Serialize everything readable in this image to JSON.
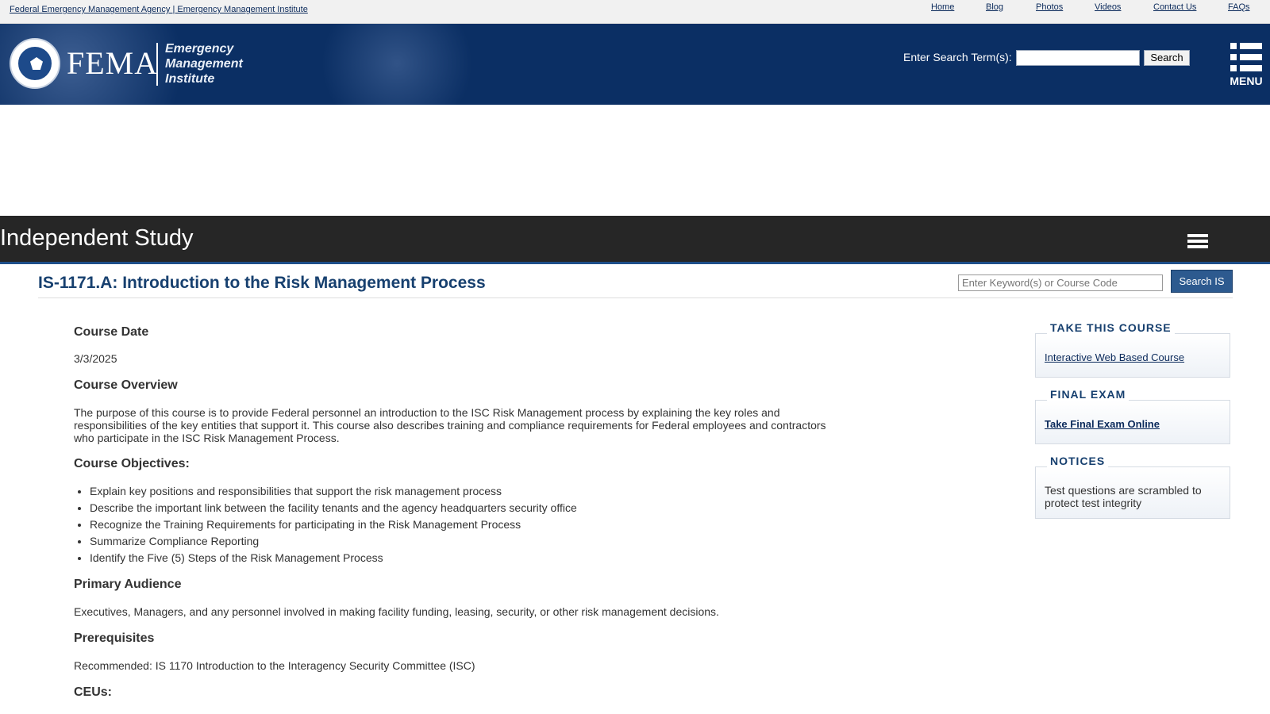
{
  "topbar": {
    "agency_link": "Federal Emergency Management Agency | Emergency Management Institute",
    "links": [
      {
        "label": "Home"
      },
      {
        "label": "Blog"
      },
      {
        "label": "Photos"
      },
      {
        "label": "Videos"
      },
      {
        "label": "Contact Us"
      },
      {
        "label": "FAQs"
      }
    ]
  },
  "header": {
    "fema_word": "FEMA",
    "emi_line1": "Emergency",
    "emi_line2": "Management",
    "emi_line3": "Institute",
    "search_label": "Enter Search Term(s):",
    "search_value": "",
    "search_button": "Search",
    "menu_label": "MENU",
    "colors": {
      "header_bg": "#0b2f64"
    }
  },
  "is_band": {
    "title": "Independent Study"
  },
  "course": {
    "title": "IS-1171.A: Introduction to the Risk Management Process",
    "search_placeholder": "Enter Keyword(s) or Course Code",
    "search_button": "Search IS"
  },
  "main": {
    "course_date_heading": "Course Date",
    "course_date": "3/3/2025",
    "overview_heading": "Course Overview",
    "overview_text": "The purpose of this course is to provide Federal personnel an introduction to the ISC Risk Management process by explaining the key roles and responsibilities of the key entities that support it. This course also describes training and compliance requirements for Federal employees and contractors who participate in the ISC Risk Management Process.",
    "objectives_heading": "Course Objectives:",
    "objectives": [
      "Explain key positions and responsibilities that support the risk management process",
      "Describe the important link between the facility tenants and the agency headquarters security office",
      "Recognize the Training Requirements for participating in the Risk Management Process",
      "Summarize Compliance Reporting",
      "Identify the Five (5) Steps of the Risk Management Process"
    ],
    "audience_heading": "Primary Audience",
    "audience_text": "Executives, Managers, and any personnel involved in making facility funding, leasing, security, or other risk management decisions.",
    "prereq_heading": "Prerequisites",
    "prereq_text": "Recommended: IS 1170 Introduction to the Interagency Security Committee (ISC)",
    "ceus_heading": "CEUs:"
  },
  "sidebar": {
    "take_course_title": "TAKE THIS COURSE",
    "take_course_link": "Interactive Web Based Course",
    "final_exam_title": "FINAL EXAM",
    "final_exam_link": "Take Final Exam Online",
    "notices_title": "NOTICES",
    "notices_text": "Test questions are scrambled to protect test integrity"
  }
}
